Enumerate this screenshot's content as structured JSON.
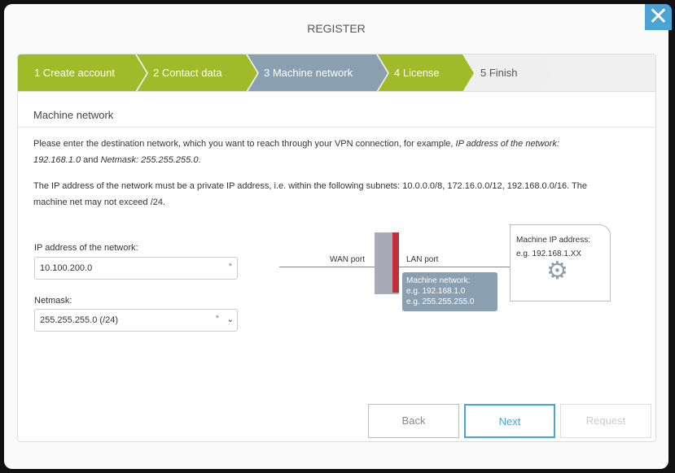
{
  "dialog": {
    "title": "REGISTER",
    "close_icon": "close-icon"
  },
  "steps": [
    {
      "label": "1  Create account",
      "state": "done"
    },
    {
      "label": "2  Contact data",
      "state": "done"
    },
    {
      "label": "3  Machine network",
      "state": "active"
    },
    {
      "label": "4  License",
      "state": "done"
    },
    {
      "label": "5  Finish",
      "state": "pending"
    }
  ],
  "section_title": "Machine network",
  "intro": {
    "text": "Please enter the destination network, which you want to reach through your VPN connection, for example, ",
    "ex1": "IP address of the network: 192.168.1.0",
    "and": " and ",
    "ex2": "Netmask: 255.255.255.0",
    "end": "."
  },
  "note": "The IP address of the network must be a private IP address, i.e. within the following subnets: 10.0.0.0/8, 172.16.0.0/12, 192.168.0.0/16. The machine net may not exceed /24.",
  "form": {
    "ip_label": "IP address of the network:",
    "ip_value": "10.100.200.0",
    "mask_label": "Netmask:",
    "mask_value": "255.255.255.0 (/24)",
    "required": "*"
  },
  "diagram": {
    "wan": "WAN port",
    "lan": "LAN port",
    "mnet_title": "Machine network:",
    "mnet_ip": "e.g. 192.168.1.0",
    "mnet_mask": "e.g. 255.255.255.0",
    "mip_title": "Machine IP address:",
    "mip_ex": "e.g. 192.168.1.XX"
  },
  "buttons": {
    "back": "Back",
    "next": "Next",
    "request": "Request"
  }
}
